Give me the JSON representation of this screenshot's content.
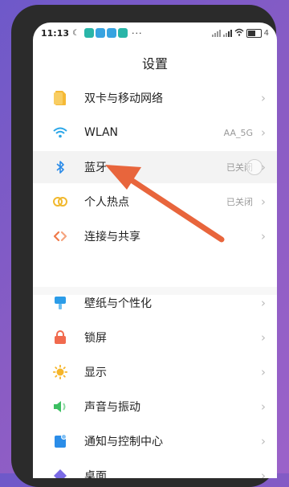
{
  "status_bar": {
    "time": "11:13",
    "more": "···",
    "battery": "4"
  },
  "header": {
    "title": "设置"
  },
  "group1": [
    {
      "label": "双卡与移动网络",
      "value": "",
      "icon": "sim-card-icon",
      "color": "#f5b935"
    },
    {
      "label": "WLAN",
      "value": "AA_5G",
      "icon": "wifi-icon",
      "color": "#2aa6e8"
    },
    {
      "label": "蓝牙",
      "value": "已关闭",
      "icon": "bluetooth-icon",
      "color": "#2a8be8"
    },
    {
      "label": "个人热点",
      "value": "已关闭",
      "icon": "hotspot-icon",
      "color": "#f1b82d"
    },
    {
      "label": "连接与共享",
      "value": "",
      "icon": "share-icon",
      "color": "#ef7a4a"
    }
  ],
  "group2": [
    {
      "label": "壁纸与个性化",
      "icon": "wallpaper-icon",
      "color": "#2b9ce8"
    },
    {
      "label": "锁屏",
      "icon": "lock-icon",
      "color": "#f16a4e"
    },
    {
      "label": "显示",
      "icon": "brightness-icon",
      "color": "#f5b52a"
    },
    {
      "label": "声音与振动",
      "icon": "speaker-icon",
      "color": "#3cbf62"
    },
    {
      "label": "通知与控制中心",
      "icon": "notification-icon",
      "color": "#2b8de8"
    },
    {
      "label": "桌面",
      "icon": "desktop-icon",
      "color": "#7b6be6"
    }
  ],
  "annotation": {
    "arrow_color": "#e8653c"
  }
}
